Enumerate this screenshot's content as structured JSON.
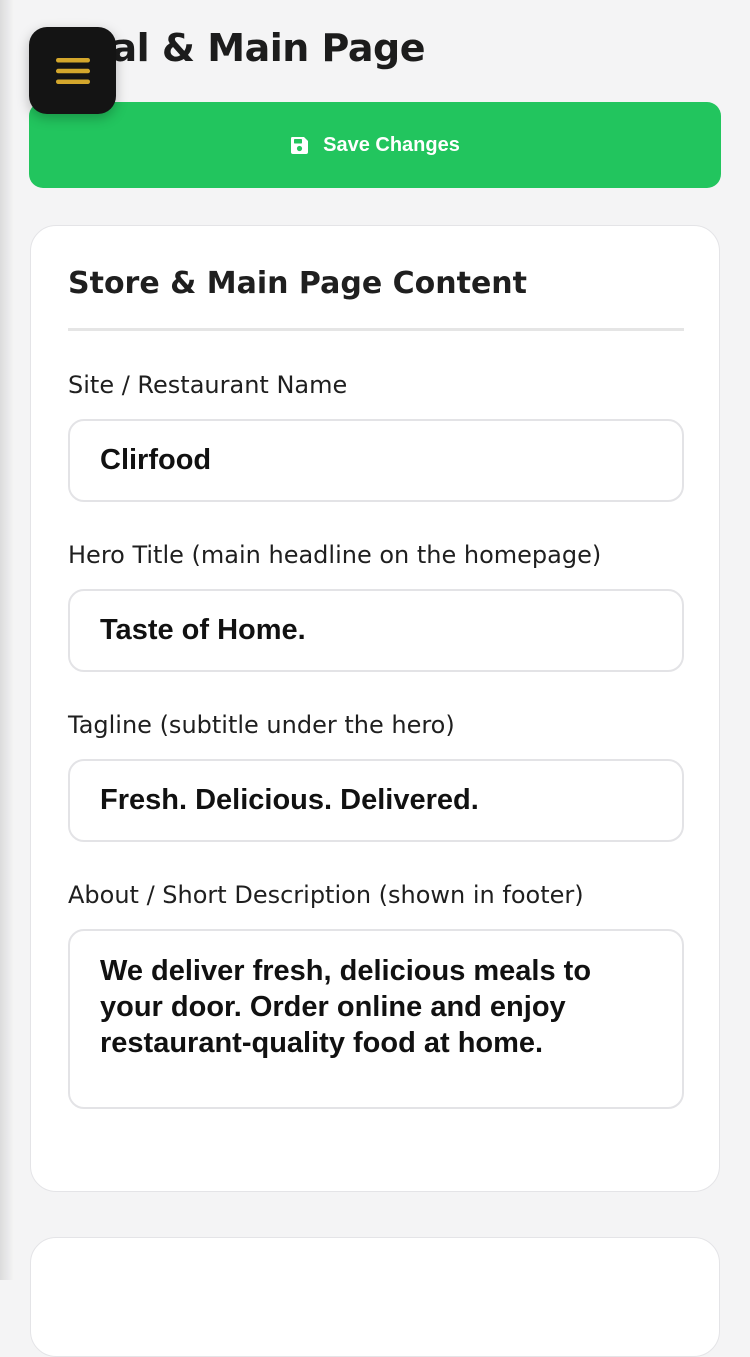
{
  "header": {
    "title": "eral & Main Page",
    "menu_icon": "hamburger-icon",
    "menu_icon_color": "#d4a72c"
  },
  "toolbar": {
    "save_label": "Save Changes",
    "save_icon": "floppy-disk-icon",
    "save_color": "#22c55e"
  },
  "card": {
    "title": "Store & Main Page Content",
    "fields": [
      {
        "label": "Site / Restaurant Name",
        "value": "Clirfood"
      },
      {
        "label": "Hero Title (main headline on the homepage)",
        "value": "Taste of Home."
      },
      {
        "label": "Tagline (subtitle under the hero)",
        "value": "Fresh. Delicious. Delivered."
      },
      {
        "label": "About / Short Description (shown in footer)",
        "value": "We deliver fresh, delicious meals to your door. Order online and enjoy restaurant-quality food at home."
      }
    ]
  }
}
